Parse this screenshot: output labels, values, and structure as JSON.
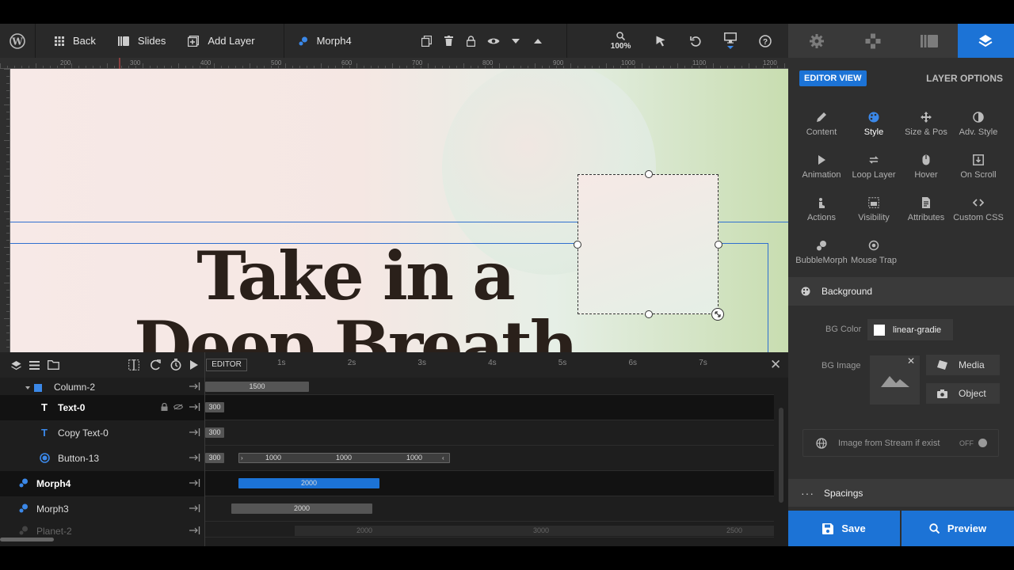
{
  "toolbar": {
    "back": "Back",
    "slides": "Slides",
    "add_layer": "Add Layer",
    "current_layer": "Morph4",
    "zoom": "100%"
  },
  "ruler": {
    "top_labels": [
      "200",
      "300",
      "400",
      "500",
      "600",
      "700",
      "800",
      "900",
      "1000",
      "1100",
      "1200"
    ]
  },
  "canvas": {
    "headline_line1": "Take in a",
    "headline_line2": "Deep Breath"
  },
  "right_panel": {
    "editor_view": "EDITOR VIEW",
    "layer_options": "LAYER OPTIONS",
    "buttons": [
      {
        "label": "Content",
        "icon": "pencil-icon"
      },
      {
        "label": "Style",
        "icon": "palette-icon",
        "active": true
      },
      {
        "label": "Size & Pos",
        "icon": "move-icon"
      },
      {
        "label": "Adv. Style",
        "icon": "contrast-icon"
      },
      {
        "label": "Animation",
        "icon": "play-icon"
      },
      {
        "label": "Loop Layer",
        "icon": "loop-icon"
      },
      {
        "label": "Hover",
        "icon": "mouse-icon"
      },
      {
        "label": "On Scroll",
        "icon": "scroll-icon"
      },
      {
        "label": "Actions",
        "icon": "pointer-icon"
      },
      {
        "label": "Visibility",
        "icon": "visibility-icon"
      },
      {
        "label": "Attributes",
        "icon": "file-icon"
      },
      {
        "label": "Custom CSS",
        "icon": "code-icon"
      },
      {
        "label": "BubbleMorph",
        "icon": "bubble-icon"
      },
      {
        "label": "Mouse Trap",
        "icon": "crosshair-icon"
      }
    ],
    "background_title": "Background",
    "bg_color_label": "BG Color",
    "bg_color_value": "linear-gradie",
    "bg_image_label": "BG Image",
    "media_btn": "Media",
    "object_btn": "Object",
    "stream_label": "Image from Stream if exist",
    "stream_toggle": "OFF",
    "spacings_title": "Spacings",
    "save": "Save",
    "preview": "Preview"
  },
  "timeline": {
    "editor_label": "EDITOR",
    "ticks": [
      "1s",
      "2s",
      "3s",
      "4s",
      "5s",
      "6s",
      "7s"
    ],
    "layers": [
      {
        "name": "Column-2",
        "bar": "1500"
      },
      {
        "name": "Text-0",
        "start": "300"
      },
      {
        "name": "Copy Text-0",
        "start": "300"
      },
      {
        "name": "Button-13",
        "start": "300",
        "segments": [
          "1000",
          "1000",
          "1000"
        ]
      },
      {
        "name": "Morph4",
        "bar": "2000"
      },
      {
        "name": "Morph3",
        "bar": "2000"
      },
      {
        "name": "Planet-2",
        "values": [
          "2000",
          "3000",
          "2500"
        ]
      }
    ]
  },
  "colors": {
    "accent": "#1c73d6",
    "panel": "#2f2f2f",
    "toolbar": "#292929"
  }
}
